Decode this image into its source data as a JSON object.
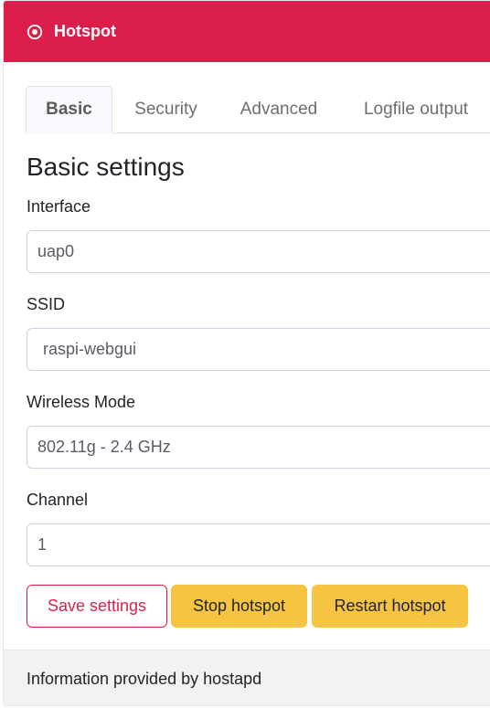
{
  "header": {
    "title": "Hotspot",
    "icon": "dot-circle-icon",
    "color": "#dc1f4a"
  },
  "tabs": [
    {
      "label": "Basic",
      "active": true
    },
    {
      "label": "Security",
      "active": false
    },
    {
      "label": "Advanced",
      "active": false
    },
    {
      "label": "Logfile output",
      "active": false
    }
  ],
  "section": {
    "title": "Basic settings"
  },
  "fields": {
    "interface": {
      "label": "Interface",
      "value": "uap0"
    },
    "ssid": {
      "label": "SSID",
      "value": "raspi-webgui"
    },
    "wireless_mode": {
      "label": "Wireless Mode",
      "value": "802.11g - 2.4 GHz"
    },
    "channel": {
      "label": "Channel",
      "value": "1"
    }
  },
  "buttons": {
    "save": "Save settings",
    "stop": "Stop hotspot",
    "restart": "Restart hotspot"
  },
  "footer": {
    "text": "Information provided by hostapd"
  }
}
